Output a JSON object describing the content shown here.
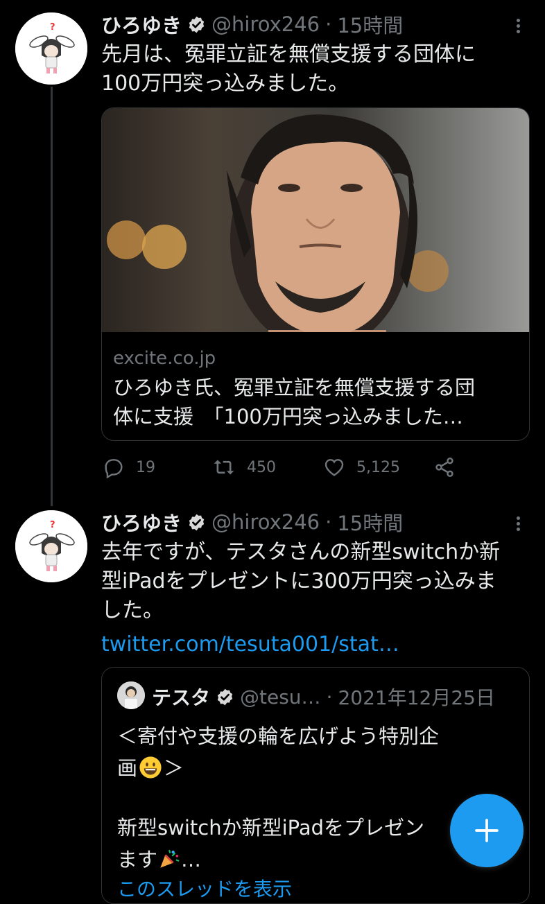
{
  "tweets": [
    {
      "name": "ひろゆき",
      "handle": "@hirox246",
      "separator": "·",
      "time": "15時間",
      "text_lines": [
        "先月は、冤罪立証を無償支援する団体に",
        "100万円突っ込みました。"
      ],
      "card": {
        "domain": "excite.co.jp",
        "title_lines": [
          "ひろゆき氏、冤罪立証を無償支援する団",
          "体に支援　「100万円突っ込みました…"
        ]
      },
      "actions": {
        "replies": "19",
        "retweets": "450",
        "likes": "5,125"
      }
    },
    {
      "name": "ひろゆき",
      "handle": "@hirox246",
      "separator": "·",
      "time": "15時間",
      "text_lines": [
        "去年ですが、テスタさんの新型switchか新",
        "型iPadをプレゼントに300万円突っ込みま",
        "した。"
      ],
      "link": "twitter.com/tesuta001/stat…"
    }
  ],
  "quote": {
    "name": "テスタ",
    "handle": "@tesu…",
    "separator": "·",
    "date": "2021年12月25日",
    "line1": "＜寄付や支援の輪を広げよう特別企",
    "line2_prefix": "画",
    "line2_suffix": "＞",
    "line3": "新型switchか新型iPadをプレゼン",
    "line4_prefix": "ます",
    "line4_suffix": "…",
    "show_thread": "このスレッドを表示"
  },
  "icons": {
    "verified": "verified-badge-icon",
    "reply": "reply-icon",
    "retweet": "retweet-icon",
    "like": "heart-icon",
    "share": "share-icon",
    "compose": "plus-icon"
  },
  "colors": {
    "accent": "#1d9bf0",
    "background": "#000000",
    "text": "#e7e9ea",
    "muted": "#71767b"
  }
}
